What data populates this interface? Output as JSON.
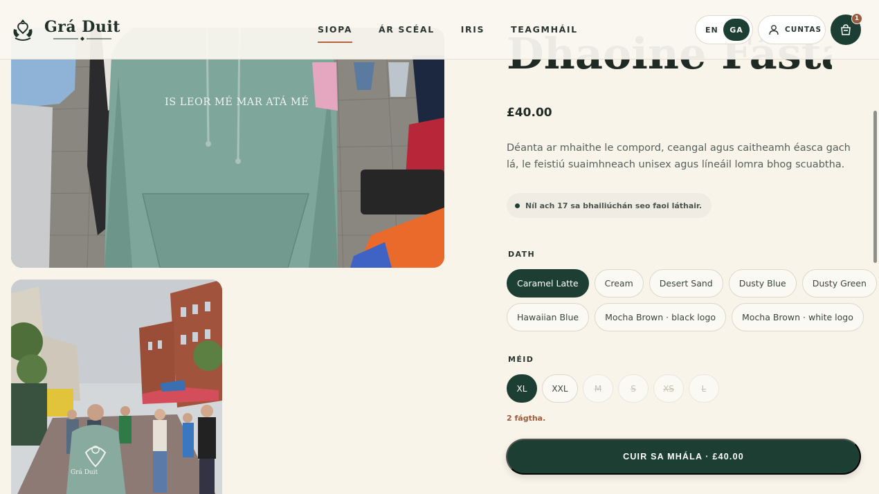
{
  "brand": {
    "name": "Grá Duit"
  },
  "nav": {
    "items": [
      {
        "label": "SIOPA",
        "active": true
      },
      {
        "label": "ÁR SCÉAL",
        "active": false
      },
      {
        "label": "IRIS",
        "active": false
      },
      {
        "label": "TEAGMHÁIL",
        "active": false
      }
    ]
  },
  "language": {
    "en_label": "EN",
    "ga_label": "GA",
    "selected": "GA"
  },
  "account": {
    "label": "CUNTAS",
    "icon": "user-icon"
  },
  "cart": {
    "count": "1",
    "icon": "shopping-bag-icon"
  },
  "gallery": {
    "hoodie_slogan": "IS LEOR MÉ MAR ATÁ MÉ",
    "print_text": "Grá Duit"
  },
  "product": {
    "title_fragment": "Dhaoine Fásta",
    "price": "£40.00",
    "description": "Déanta ar mhaithe le compord, ceangal agus caitheamh éasca gach lá, le feistiú suaimhneach unisex agus líneáil lomra bhog scuabtha.",
    "stock_notice": "Níl ach 17 sa bhailiúchán seo faoi láthair."
  },
  "color": {
    "label": "DATH",
    "selected": "Caramel Latte",
    "options": [
      "Caramel Latte",
      "Cream",
      "Desert Sand",
      "Dusty Blue",
      "Dusty Green",
      "Hawaiian Blue",
      "Mocha Brown · black logo",
      "Mocha Brown · white logo"
    ]
  },
  "size": {
    "label": "MÉID",
    "options": [
      {
        "label": "XL",
        "state": "selected"
      },
      {
        "label": "XXL",
        "state": "available"
      },
      {
        "label": "M",
        "state": "unavailable"
      },
      {
        "label": "S",
        "state": "unavailable"
      },
      {
        "label": "XS",
        "state": "unavailable"
      },
      {
        "label": "L",
        "state": "unavailable"
      }
    ],
    "low_stock": "2 fágtha."
  },
  "add_to_bag": {
    "label": "CUIR SA MHÁLA · £40.00"
  },
  "colors": {
    "primary": "#1d3f33",
    "accent": "#b5633f",
    "background": "#f8f4ea",
    "warning_text": "#9b5a3c"
  }
}
